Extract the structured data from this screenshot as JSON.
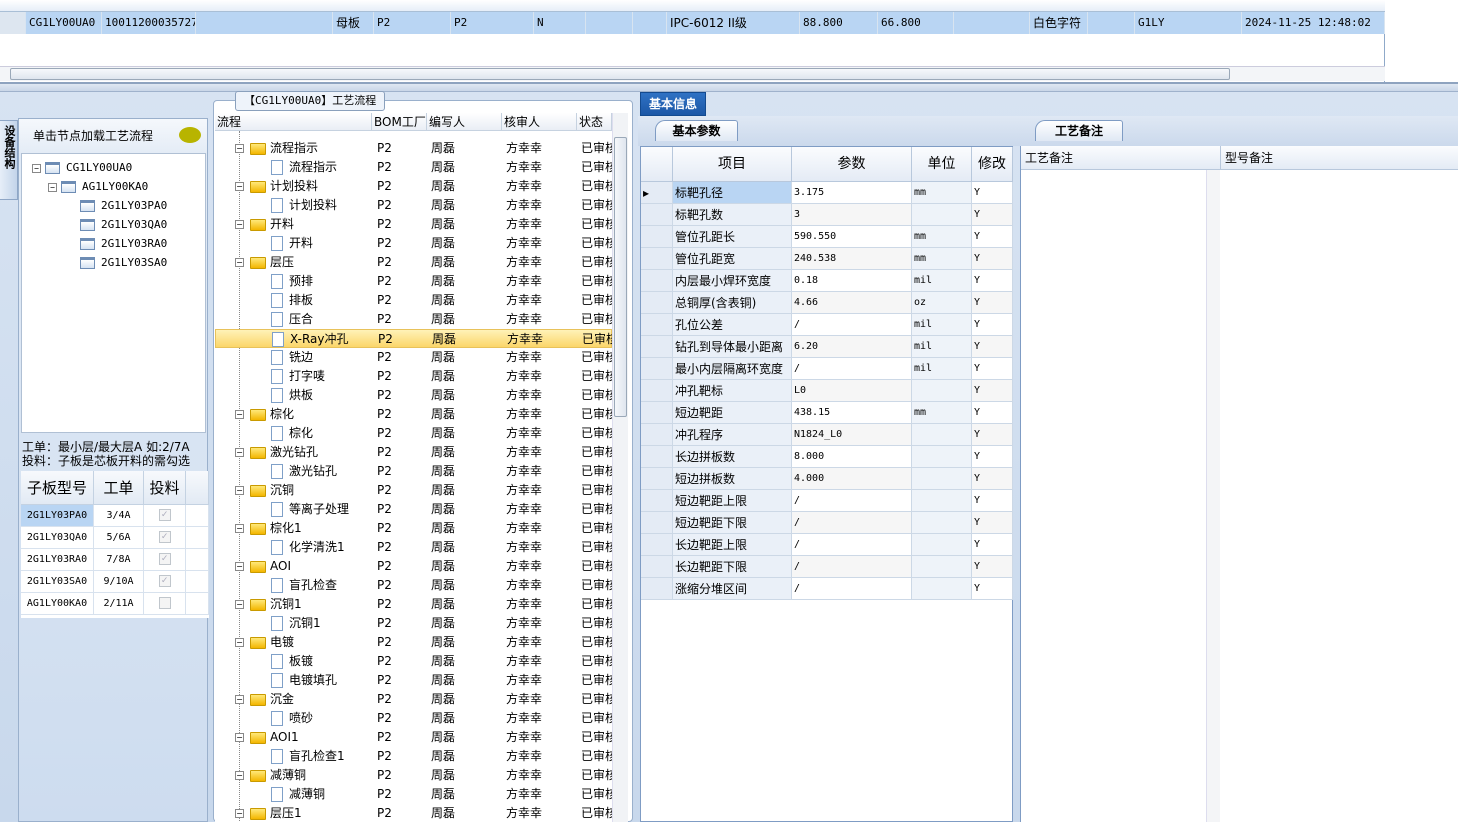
{
  "top_grid": {
    "row": [
      "CG1LY00UA0",
      "10011200035727",
      "",
      "母板",
      "P2",
      "P2",
      "N",
      "",
      "",
      "IPC-6012 II级",
      "88.800",
      "66.800",
      "",
      "白色字符",
      "",
      "G1LY",
      "2024-11-25 12:48:02"
    ]
  },
  "left": {
    "vtab": "设备结构",
    "header": "单击节点加载工艺流程",
    "tree": [
      "CG1LY00UA0",
      "AG1LY00KA0",
      "2G1LY03PA0",
      "2G1LY03QA0",
      "2G1LY03RA0",
      "2G1LY03SA0"
    ],
    "note1": "工单：最小层/最大层A 如:2/7A",
    "note2": "投料：子板是芯板开料的需勾选",
    "grid_headers": [
      "子板型号",
      "工单",
      "投料"
    ],
    "grid_rows": [
      {
        "model": "2G1LY03PA0",
        "order": "3/4A",
        "feed": true
      },
      {
        "model": "2G1LY03QA0",
        "order": "5/6A",
        "feed": true
      },
      {
        "model": "2G1LY03RA0",
        "order": "7/8A",
        "feed": true
      },
      {
        "model": "2G1LY03SA0",
        "order": "9/10A",
        "feed": true
      },
      {
        "model": "AG1LY00KA0",
        "order": "2/11A",
        "feed": false
      }
    ]
  },
  "flow": {
    "title": "【CG1LY00UA0】工艺流程",
    "headers": [
      "流程",
      "BOM工厂",
      "编写人",
      "核审人",
      "状态"
    ],
    "rows": [
      {
        "name": "流程指示",
        "level": 1
      },
      {
        "name": "流程指示",
        "level": 2
      },
      {
        "name": "计划投料",
        "level": 1
      },
      {
        "name": "计划投料",
        "level": 2
      },
      {
        "name": "开料",
        "level": 1
      },
      {
        "name": "开料",
        "level": 2
      },
      {
        "name": "层压",
        "level": 1
      },
      {
        "name": "预排",
        "level": 2
      },
      {
        "name": "排板",
        "level": 2
      },
      {
        "name": "压合",
        "level": 2
      },
      {
        "name": "X-Ray冲孔",
        "level": 2,
        "selected": true
      },
      {
        "name": "铣边",
        "level": 2
      },
      {
        "name": "打字唛",
        "level": 2
      },
      {
        "name": "烘板",
        "level": 2
      },
      {
        "name": "棕化",
        "level": 1
      },
      {
        "name": "棕化",
        "level": 2
      },
      {
        "name": "激光钻孔",
        "level": 1
      },
      {
        "name": "激光钻孔",
        "level": 2
      },
      {
        "name": "沉铜",
        "level": 1
      },
      {
        "name": "等离子处理",
        "level": 2
      },
      {
        "name": "棕化1",
        "level": 1
      },
      {
        "name": "化学清洗1",
        "level": 2
      },
      {
        "name": "AOI",
        "level": 1
      },
      {
        "name": "盲孔检查",
        "level": 2
      },
      {
        "name": "沉铜1",
        "level": 1
      },
      {
        "name": "沉铜1",
        "level": 2
      },
      {
        "name": "电镀",
        "level": 1
      },
      {
        "name": "板镀",
        "level": 2
      },
      {
        "name": "电镀填孔",
        "level": 2
      },
      {
        "name": "沉金",
        "level": 1
      },
      {
        "name": "喷砂",
        "level": 2
      },
      {
        "name": "AOI1",
        "level": 1
      },
      {
        "name": "盲孔检查1",
        "level": 2
      },
      {
        "name": "减薄铜",
        "level": 1
      },
      {
        "name": "减薄铜",
        "level": 2
      },
      {
        "name": "层压1",
        "level": 1
      }
    ],
    "factory": "P2",
    "writer": "周磊",
    "reviewer": "方幸幸",
    "status": "已审核"
  },
  "right": {
    "main_tab": "基本信息",
    "sub_tab": "基本参数",
    "headers": [
      "项目",
      "参数",
      "单位",
      "修改"
    ],
    "rows": [
      [
        "标靶孔径",
        "3.175",
        "mm",
        "Y"
      ],
      [
        "标靶孔数",
        "3",
        "",
        "Y"
      ],
      [
        "管位孔距长",
        "590.550",
        "mm",
        "Y"
      ],
      [
        "管位孔距宽",
        "240.538",
        "mm",
        "Y"
      ],
      [
        "内层最小焊环宽度",
        "0.18",
        "mil",
        "Y"
      ],
      [
        "总铜厚(含表铜)",
        "4.66",
        "oz",
        "Y"
      ],
      [
        "孔位公差",
        "/",
        "mil",
        "Y"
      ],
      [
        "钻孔到导体最小距离",
        "6.20",
        "mil",
        "Y"
      ],
      [
        "最小内层隔离环宽度",
        "/",
        "mil",
        "Y"
      ],
      [
        "冲孔靶标",
        "L0",
        "",
        "Y"
      ],
      [
        "短边靶距",
        "438.15",
        "mm",
        "Y"
      ],
      [
        "冲孔程序",
        "N1824_L0",
        "",
        "Y"
      ],
      [
        "长边拼板数",
        "8.000",
        "",
        "Y"
      ],
      [
        "短边拼板数",
        "4.000",
        "",
        "Y"
      ],
      [
        "短边靶距上限",
        "/",
        "",
        "Y"
      ],
      [
        "短边靶距下限",
        "/",
        "",
        "Y"
      ],
      [
        "长边靶距上限",
        "/",
        "",
        "Y"
      ],
      [
        "长边靶距下限",
        "/",
        "",
        "Y"
      ],
      [
        "涨缩分堆区间",
        "/",
        "",
        "Y"
      ]
    ],
    "notes_tab": "工艺备注",
    "notes_headers": [
      "工艺备注",
      "型号备注"
    ]
  },
  "colors": {
    "selected_row": "#b9d5f3",
    "highlight": "#fbd66a",
    "tab_blue": "#1c57a6"
  }
}
